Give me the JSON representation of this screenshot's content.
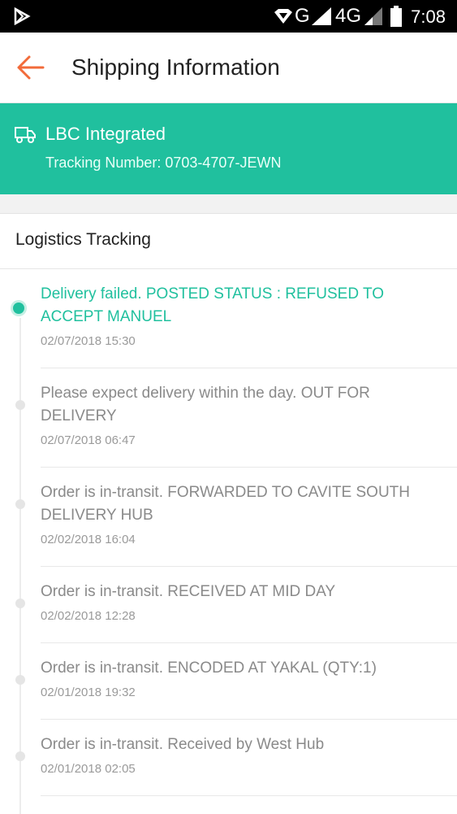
{
  "status_bar": {
    "time": "7:08",
    "network_1": "G",
    "network_2": "4G",
    "icons": [
      "play-store-icon",
      "wifi-diamond-icon",
      "signal-icon",
      "battery-icon"
    ]
  },
  "header": {
    "title": "Shipping Information",
    "back_icon": "arrow-left-icon",
    "accent_color": "#f26b3a"
  },
  "carrier": {
    "name": "LBC Integrated",
    "tracking_label": "Tracking Number: 0703-4707-JEWN",
    "icon": "truck-icon",
    "bg_color": "#20c09e"
  },
  "logistics": {
    "title": "Logistics Tracking",
    "events": [
      {
        "text": "Delivery failed. POSTED STATUS : REFUSED TO ACCEPT MANUEL",
        "time": "02/07/2018 15:30",
        "active": true
      },
      {
        "text": "Please expect delivery within the day. OUT FOR DELIVERY",
        "time": "02/07/2018 06:47",
        "active": false
      },
      {
        "text": "Order is in-transit. FORWARDED TO CAVITE SOUTH DELIVERY HUB",
        "time": "02/02/2018 16:04",
        "active": false
      },
      {
        "text": "Order is in-transit. RECEIVED AT MID DAY",
        "time": "02/02/2018 12:28",
        "active": false
      },
      {
        "text": "Order is in-transit. ENCODED AT YAKAL (QTY:1)",
        "time": "02/01/2018 19:32",
        "active": false
      },
      {
        "text": "Order is in-transit. Received by West Hub",
        "time": "02/01/2018 02:05",
        "active": false
      }
    ]
  }
}
